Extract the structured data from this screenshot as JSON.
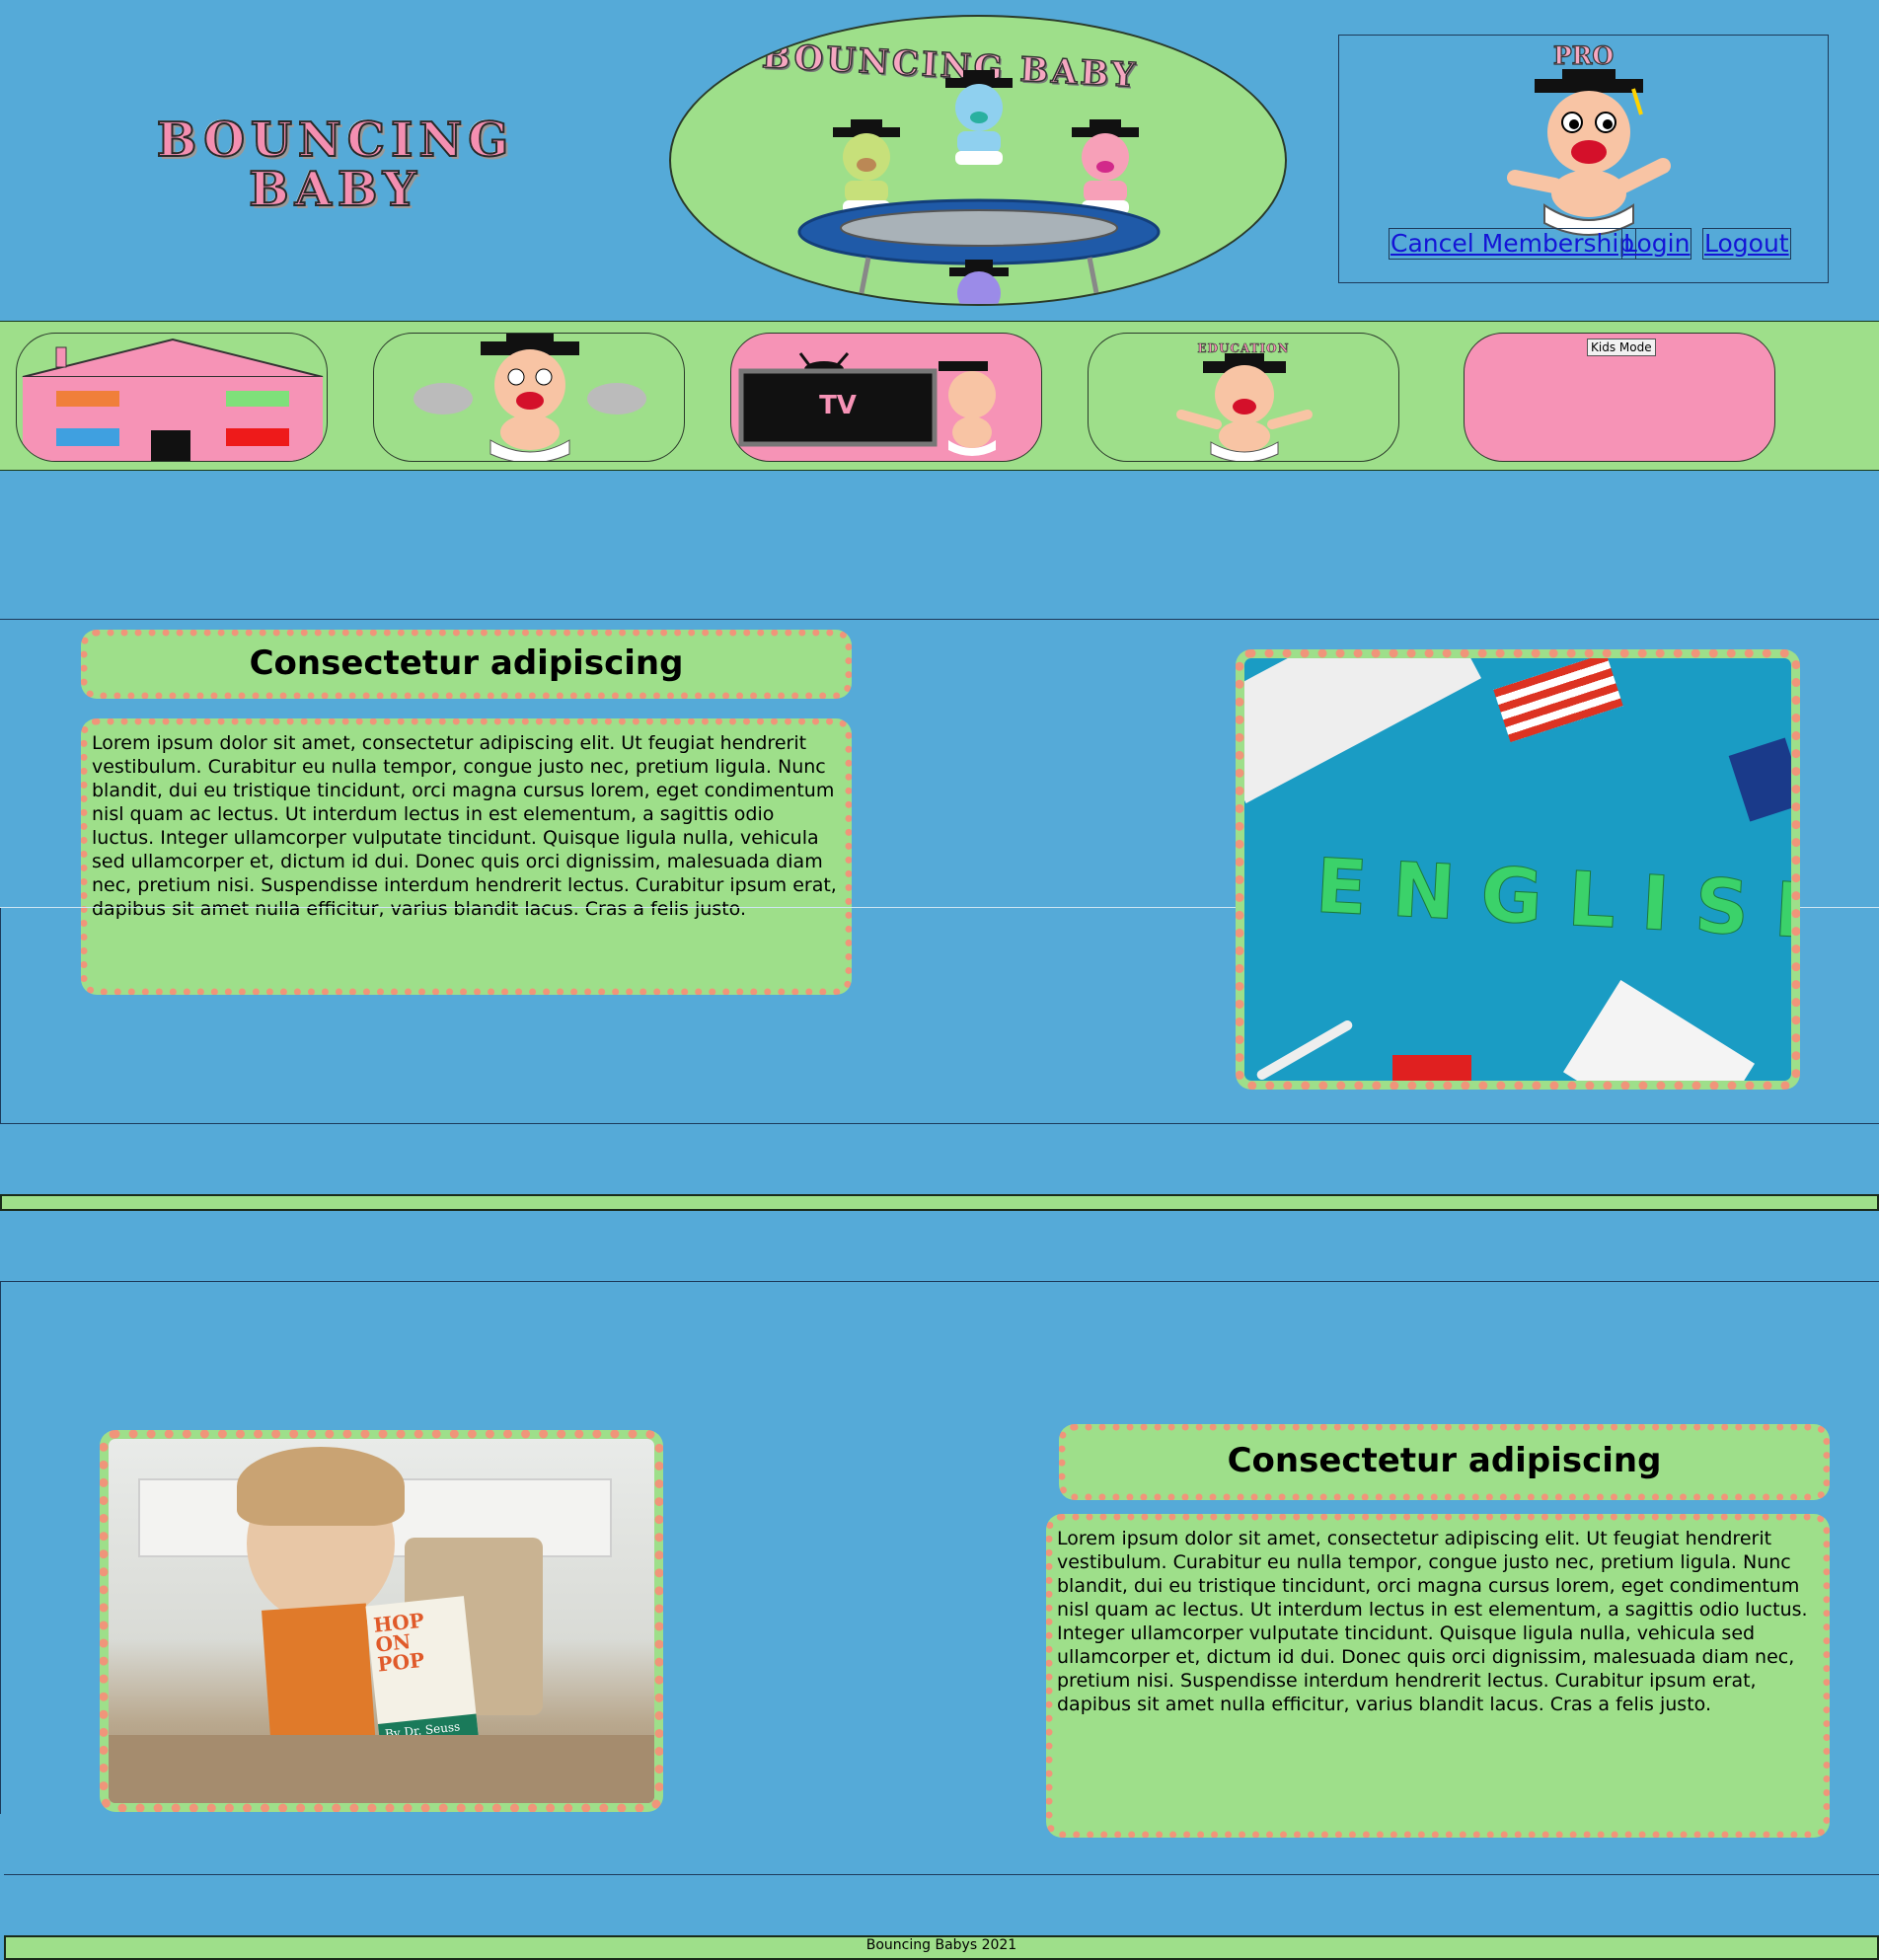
{
  "header": {
    "logo_line1": "BOUNCING",
    "logo_line2": "BABY",
    "hero_title": "BOUNCING BABY",
    "pro_label": "PRO",
    "links": {
      "cancel": "Cancel Membership",
      "login": "Login",
      "logout": "Logout"
    }
  },
  "nav": {
    "tv_label": "TV",
    "education_label": "EDUCATION",
    "kids_mode": "Kids Mode"
  },
  "section1": {
    "title": "Consectetur adipiscing",
    "body": "Lorem ipsum dolor sit amet, consectetur adipiscing elit. Ut feugiat hendrerit vestibulum. Curabitur eu nulla tempor, congue justo nec, pretium ligula. Nunc blandit, dui eu tristique tincidunt, orci magna cursus lorem, eget condimentum nisl quam ac lectus. Ut interdum lectus in est elementum, a sagittis odio luctus. Integer ullamcorper vulputate tincidunt. Quisque ligula nulla, vehicula sed ullamcorper et, dictum id dui. Donec quis orci dignissim, malesuada diam nec, pretium nisi. Suspendisse interdum hendrerit lectus. Curabitur ipsum erat, dapibus sit amet nulla efficitur, varius blandit lacus. Cras a felis justo.",
    "image_word": "ENGLISH"
  },
  "section2": {
    "title": "Consectetur adipiscing",
    "body": "Lorem ipsum dolor sit amet, consectetur adipiscing elit. Ut feugiat hendrerit vestibulum. Curabitur eu nulla tempor, congue justo nec, pretium ligula. Nunc blandit, dui eu tristique tincidunt, orci magna cursus lorem, eget condimentum nisl quam ac lectus. Ut interdum lectus in est elementum, a sagittis odio luctus. Integer ullamcorper vulputate tincidunt. Quisque ligula nulla, vehicula sed ullamcorper et, dictum id dui. Donec quis orci dignissim, malesuada diam nec, pretium nisi. Suspendisse interdum hendrerit lectus. Curabitur ipsum erat, dapibus sit amet nulla efficitur, varius blandit lacus. Cras a felis justo.",
    "book_title": "HOP ON POP",
    "book_author": "By Dr. Seuss"
  },
  "footer": {
    "text": "Bouncing Babys 2021"
  },
  "colors": {
    "page_bg": "#55aad8",
    "green": "#9edf8a",
    "pink": "#f693b6",
    "dot_border": "#f0957a",
    "link": "#1414d6"
  }
}
